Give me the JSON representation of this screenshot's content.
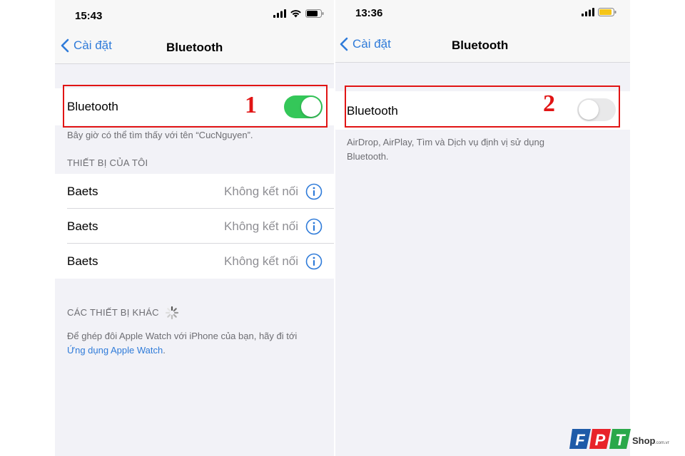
{
  "left_screen": {
    "status_time": "15:43",
    "back_label": "Cài đặt",
    "title": "Bluetooth",
    "bluetooth_label": "Bluetooth",
    "bluetooth_on": true,
    "discoverable_text": "Bây giờ có thể tìm thấy với tên “CucNguyen”.",
    "my_devices_header": "THIẾT BỊ CỦA TÔI",
    "devices": [
      {
        "name": "Baets",
        "status": "Không kết nối"
      },
      {
        "name": "Baets",
        "status": "Không kết nối"
      },
      {
        "name": "Baets",
        "status": "Không kết nối"
      }
    ],
    "other_devices_header": "CÁC THIẾT BỊ KHÁC",
    "pair_text": "Để ghép đôi Apple Watch với iPhone của bạn, hãy đi tới",
    "pair_link": "Ứng dụng Apple Watch",
    "pair_end": "."
  },
  "right_screen": {
    "status_time": "13:36",
    "back_label": "Cài đặt",
    "title": "Bluetooth",
    "bluetooth_label": "Bluetooth",
    "bluetooth_on": false,
    "footer_line1": "AirDrop, AirPlay, Tìm và Dịch vụ định vị sử dụng",
    "footer_line2": "Bluetooth."
  },
  "annotations": {
    "step1": "1",
    "step2": "2",
    "highlight_color": "#e11414"
  },
  "watermark": {
    "brand": "FPT",
    "suffix": "Shop",
    "domain": ".com.vn"
  },
  "colors": {
    "ios_blue": "#2f7bd9",
    "toggle_on": "#34c759",
    "toggle_off": "#e9e9ea",
    "battery_low": "#f5c518"
  }
}
